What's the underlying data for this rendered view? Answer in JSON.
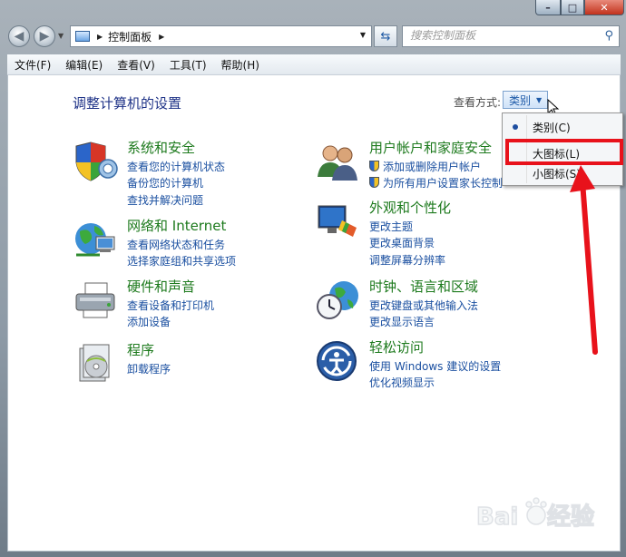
{
  "navigation": {
    "breadcrumb": "控制面板",
    "search_placeholder": "搜索控制面板"
  },
  "menu": [
    "文件(F)",
    "编辑(E)",
    "查看(V)",
    "工具(T)",
    "帮助(H)"
  ],
  "page": {
    "title": "调整计算机的设置",
    "view_by_label": "查看方式:",
    "view_by_value": "类别"
  },
  "categories": [
    {
      "title": "系统和安全",
      "links": [
        "查看您的计算机状态",
        "备份您的计算机",
        "查找并解决问题"
      ],
      "icon": "system-security-icon"
    },
    {
      "title": "网络和 Internet",
      "links": [
        "查看网络状态和任务",
        "选择家庭组和共享选项"
      ],
      "icon": "network-icon"
    },
    {
      "title": "硬件和声音",
      "links": [
        "查看设备和打印机",
        "添加设备"
      ],
      "icon": "printer-icon"
    },
    {
      "title": "程序",
      "links": [
        "卸载程序"
      ],
      "icon": "programs-icon"
    },
    {
      "title": "用户帐户和家庭安全",
      "links": [
        "添加或删除用户帐户",
        "为所有用户设置家长控制"
      ],
      "icon": "users-icon"
    },
    {
      "title": "外观和个性化",
      "links": [
        "更改主题",
        "更改桌面背景",
        "调整屏幕分辨率"
      ],
      "icon": "appearance-icon"
    },
    {
      "title": "时钟、语言和区域",
      "links": [
        "更改键盘或其他输入法",
        "更改显示语言"
      ],
      "icon": "clock-globe-icon"
    },
    {
      "title": "轻松访问",
      "links": [
        "使用 Windows 建议的设置",
        "优化视频显示"
      ],
      "icon": "ease-of-access-icon"
    }
  ],
  "view_menu": {
    "items": [
      "类别(C)",
      "大图标(L)",
      "小图标(S)"
    ],
    "selected": "类别(C)",
    "highlighted": "大图标(L)"
  },
  "watermark": "Baidu经验",
  "colors": {
    "title_blue": "#1e3287",
    "category_green": "#1d7a1d",
    "link_blue": "#1a4fa0",
    "annotation_red": "#e8121b"
  }
}
